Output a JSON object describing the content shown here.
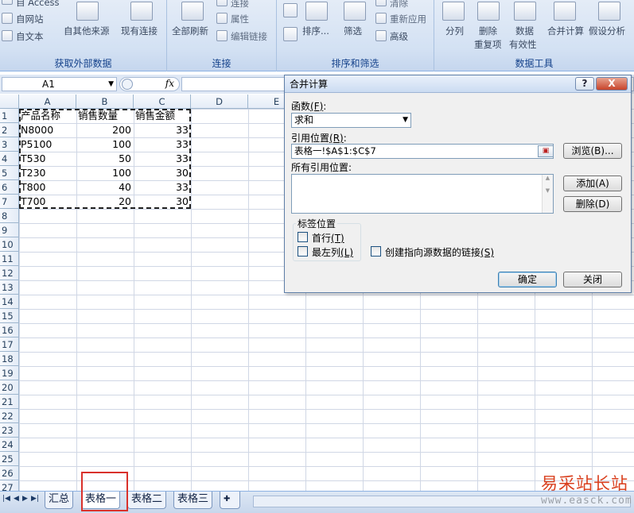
{
  "ribbon": {
    "external": {
      "access": "自 Access",
      "web": "自网站",
      "text": "自文本",
      "other": "自其他来源",
      "existing": "现有连接",
      "label": "获取外部数据"
    },
    "connections": {
      "refresh_all": "全部刷新",
      "connections": "连接",
      "properties": "属性",
      "edit_links": "编辑链接",
      "label": "连接"
    },
    "sort_filter": {
      "sort": "排序...",
      "filter": "筛选",
      "clear": "清除",
      "reapply": "重新应用",
      "advanced": "高级",
      "label": "排序和筛选"
    },
    "data_tools": {
      "split": "分列",
      "remove_dup_1": "删除",
      "remove_dup_2": "重复项",
      "validation_1": "数据",
      "validation_2": "有效性",
      "consolidate": "合并计算",
      "whatif": "假设分析",
      "label": "数据工具"
    }
  },
  "formula_bar": {
    "name_box": "A1",
    "fx": "fx",
    "formula": ""
  },
  "grid": {
    "columns": [
      "A",
      "B",
      "C",
      "D",
      "E"
    ],
    "rows": [
      "1",
      "2",
      "3",
      "4",
      "5",
      "6",
      "7",
      "8",
      "9",
      "10",
      "11",
      "12",
      "13",
      "14",
      "15",
      "16",
      "17",
      "18",
      "19",
      "20",
      "21",
      "22",
      "23",
      "24",
      "25",
      "26",
      "27"
    ],
    "header": [
      "产品名称",
      "销售数量",
      "销售金额"
    ],
    "data": [
      [
        "N8000",
        "200",
        "33"
      ],
      [
        "P5100",
        "100",
        "33"
      ],
      [
        "T530",
        "50",
        "33"
      ],
      [
        "T230",
        "100",
        "30"
      ],
      [
        "T800",
        "40",
        "33"
      ],
      [
        "T700",
        "20",
        "30"
      ]
    ]
  },
  "dialog": {
    "title": "合并计算",
    "help": "?",
    "close": "X",
    "function_label": "函数",
    "function_key": "(F)",
    "function_value": "求和",
    "reference_label": "引用位置",
    "reference_key": "(R)",
    "reference_value": "表格一!$A$1:$C$7",
    "browse": "浏览(B)...",
    "all_refs_label": "所有引用位置:",
    "add": "添加(A)",
    "delete": "删除(D)",
    "labels_group": "标签位置",
    "top_row": "首行",
    "top_row_key": "(T)",
    "left_col": "最左列",
    "left_col_key": "(L)",
    "create_links": "创建指向源数据的链接",
    "create_links_key": "(S)",
    "ok": "确定",
    "cancel": "关闭"
  },
  "sheet_tabs": {
    "tabs": [
      "汇总",
      "表格一",
      "表格二",
      "表格三"
    ],
    "active": "表格一"
  },
  "watermark": {
    "line1": "易采站长站",
    "line2": "www.easck.com"
  },
  "colors": {
    "highlight_box": "#d9312b",
    "ribbon_label": "#15428b"
  }
}
